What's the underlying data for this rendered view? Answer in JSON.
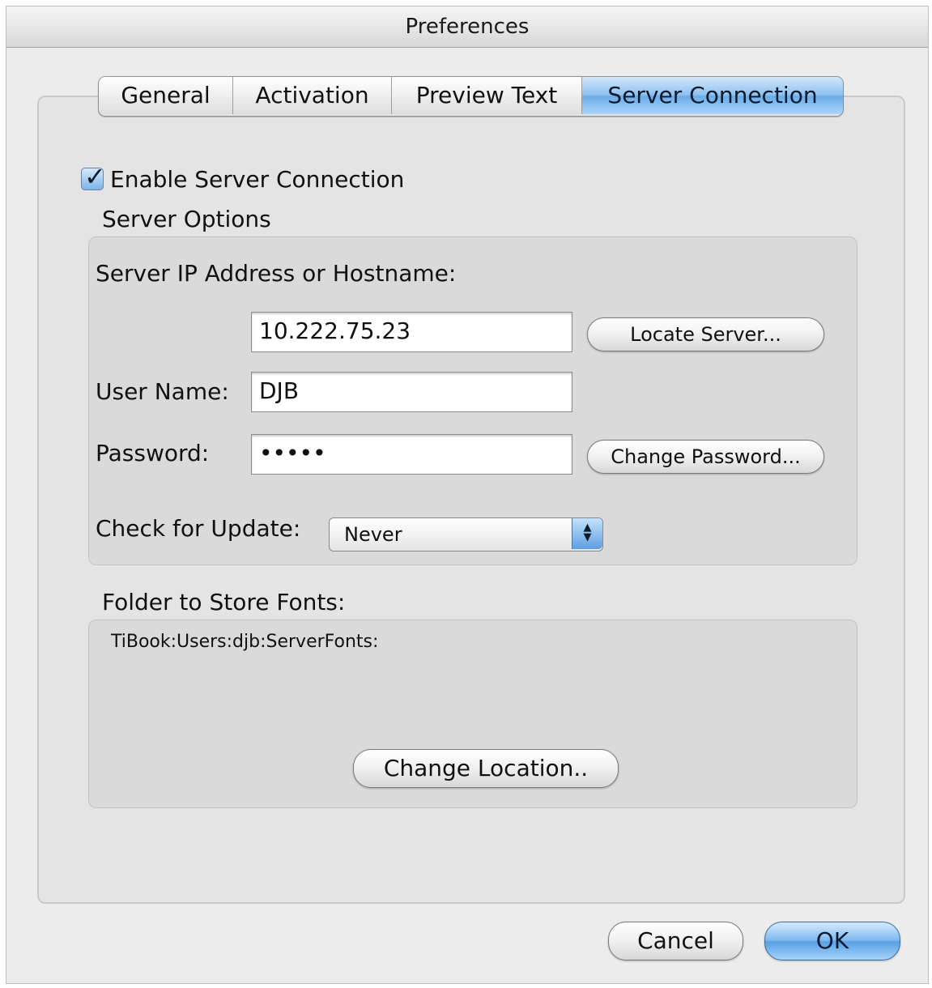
{
  "window": {
    "title": "Preferences"
  },
  "tabs": [
    {
      "label": "General",
      "selected": false
    },
    {
      "label": "Activation",
      "selected": false
    },
    {
      "label": "Preview Text",
      "selected": false
    },
    {
      "label": "Server Connection",
      "selected": true
    }
  ],
  "enable_server": {
    "label": "Enable Server Connection",
    "checked": true
  },
  "server_options": {
    "title": "Server Options",
    "host_label": "Server IP Address or Hostname:",
    "host_value": "10.222.75.23",
    "locate_button": "Locate Server...",
    "user_label": "User Name:",
    "user_value": "DJB",
    "password_label": "Password:",
    "password_value": "•••••",
    "change_password_button": "Change Password...",
    "update_label": "Check for Update:",
    "update_value": "Never"
  },
  "fonts_folder": {
    "title": "Folder to Store Fonts:",
    "path": "TiBook:Users:djb:ServerFonts:",
    "change_button": "Change Location.."
  },
  "footer": {
    "cancel": "Cancel",
    "ok": "OK"
  },
  "colors": {
    "accent": "#6cabe7",
    "window_bg": "#ececec"
  }
}
